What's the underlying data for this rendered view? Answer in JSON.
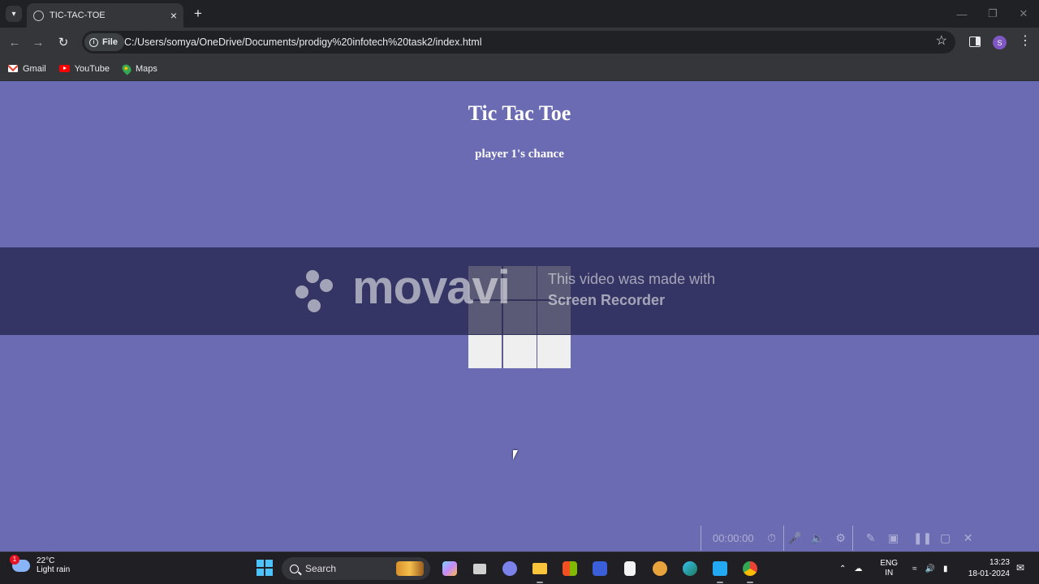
{
  "browser": {
    "tab_title": "TIC-TAC-TOE",
    "url_prefix": "File",
    "url": "C:/Users/somya/OneDrive/Documents/prodigy%20infotech%20task2/index.html",
    "profile_initial": "S",
    "bookmarks": [
      {
        "label": "Gmail",
        "icon": "gmail-icon"
      },
      {
        "label": "YouTube",
        "icon": "youtube-icon"
      },
      {
        "label": "Maps",
        "icon": "maps-icon"
      }
    ]
  },
  "game": {
    "title": "Tic Tac Toe",
    "status": "player 1's chance",
    "cells": [
      "",
      "",
      "",
      "",
      "",
      "",
      "",
      "",
      ""
    ]
  },
  "watermark": {
    "brand": "movavi",
    "line1": "This video was made with",
    "line2": "Screen Recorder"
  },
  "recorder": {
    "time": "00:00:00"
  },
  "taskbar": {
    "weather_temp": "22°C",
    "weather_condition": "Light rain",
    "weather_badge": "1",
    "search_label": "Search",
    "lang_top": "ENG",
    "lang_bottom": "IN",
    "time": "13:23",
    "date": "18-01-2024"
  },
  "colors": {
    "page_background": "#6b6bb3",
    "cell_background": "#efefef",
    "browser_dark": "#202124"
  }
}
